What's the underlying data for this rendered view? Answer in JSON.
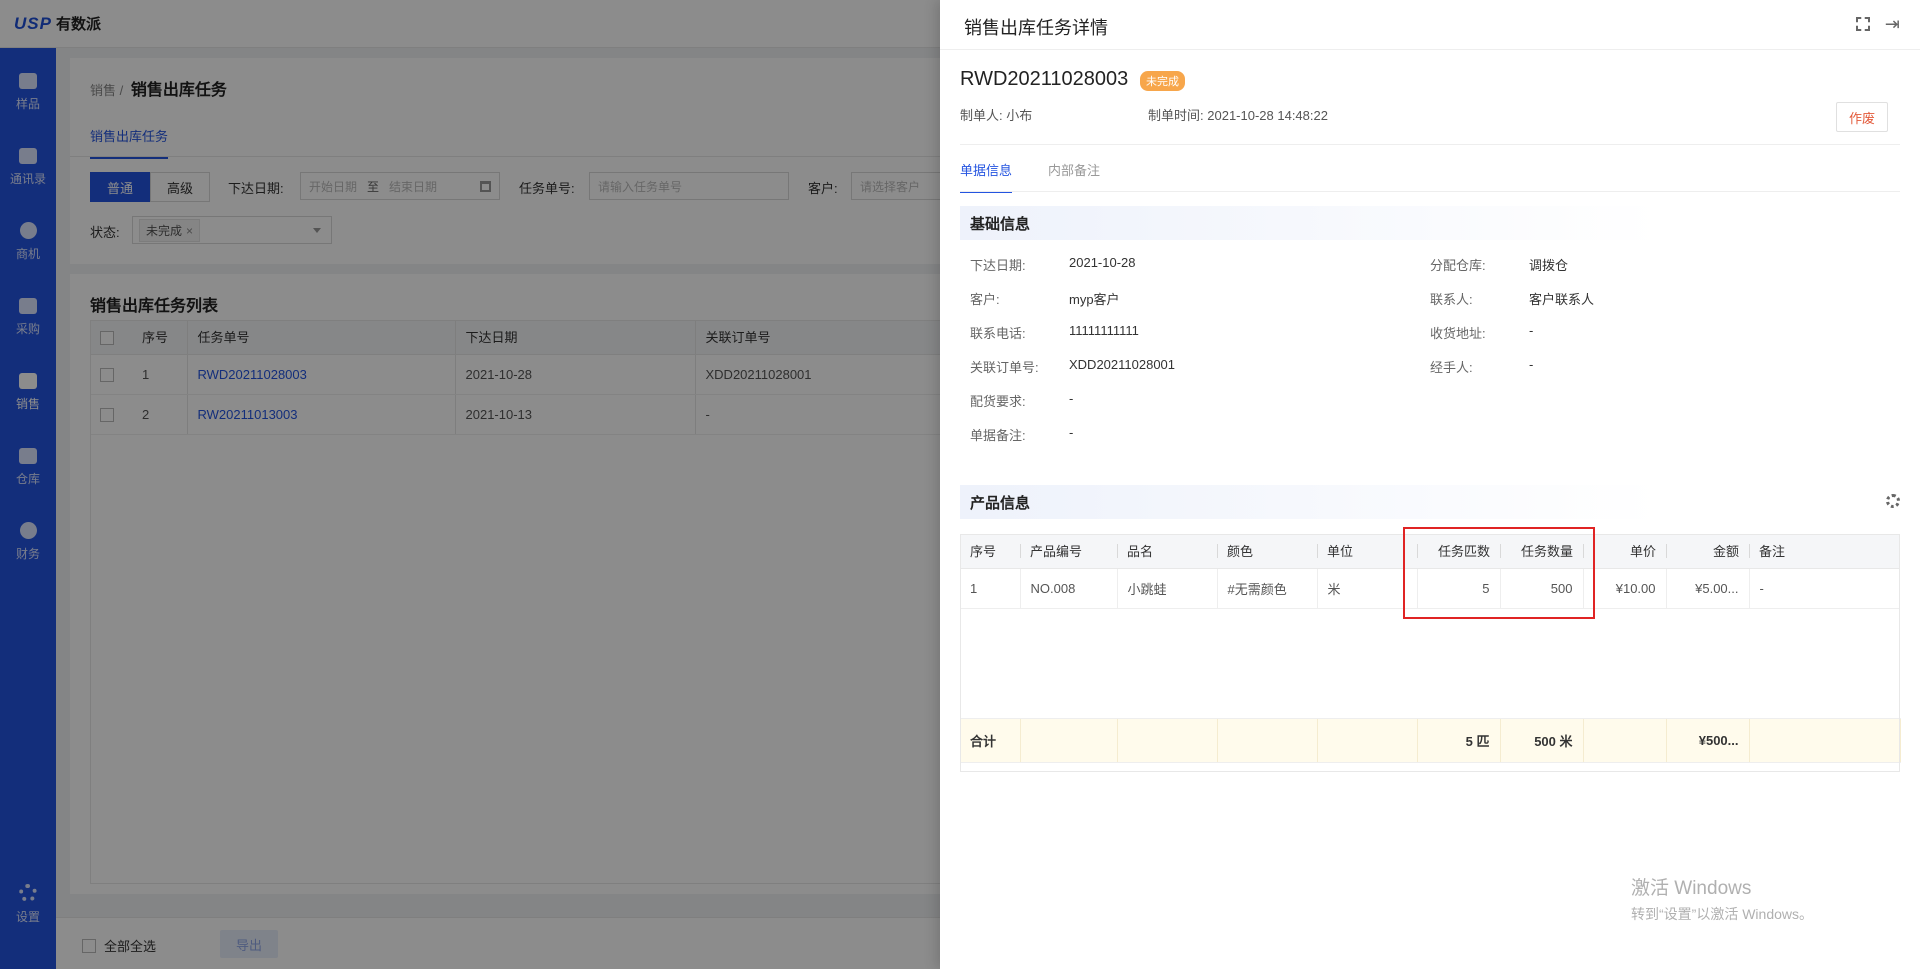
{
  "app": {
    "logo_mark": "USP",
    "logo_name": "有数派"
  },
  "sidebar": {
    "items": [
      {
        "label": "样品",
        "icon": "box-icon"
      },
      {
        "label": "通讯录",
        "icon": "contacts-icon"
      },
      {
        "label": "商机",
        "icon": "opportunity-icon"
      },
      {
        "label": "采购",
        "icon": "purchase-icon"
      },
      {
        "label": "销售",
        "icon": "sales-clipboard-icon",
        "active": true
      },
      {
        "label": "仓库",
        "icon": "warehouse-icon"
      },
      {
        "label": "财务",
        "icon": "finance-bag-icon"
      }
    ],
    "settings": "设置"
  },
  "main": {
    "breadcrumb_root": "销售",
    "breadcrumb_sep": "/",
    "breadcrumb_current": "销售出库任务",
    "subtab": "销售出库任务",
    "mode_normal": "普通",
    "mode_advanced": "高级",
    "filter_date_label": "下达日期:",
    "filter_date_start": "开始日期",
    "filter_date_to": "至",
    "filter_date_end": "结束日期",
    "filter_task_label": "任务单号:",
    "filter_task_placeholder": "请输入任务单号",
    "filter_customer_label": "客户:",
    "filter_customer_placeholder": "请选择客户",
    "filter_status_label": "状态:",
    "filter_status_tag": "未完成",
    "list_title": "销售出库任务列表",
    "columns": [
      "序号",
      "任务单号",
      "下达日期",
      "关联订单号"
    ],
    "rows": [
      {
        "idx": "1",
        "task_no": "RWD20211028003",
        "date": "2021-10-28",
        "order_no": "XDD20211028001"
      },
      {
        "idx": "2",
        "task_no": "RW20211013003",
        "date": "2021-10-13",
        "order_no": "-"
      }
    ],
    "select_all": "全部全选",
    "export": "导出"
  },
  "drawer": {
    "title": "销售出库任务详情",
    "doc_no": "RWD20211028003",
    "status": "未完成",
    "creator_label": "制单人:",
    "creator": "小布",
    "created_label": "制单时间:",
    "created_at": "2021-10-28 14:48:22",
    "void_button": "作废",
    "tabs": [
      "单据信息",
      "内部备注"
    ],
    "basic_title": "基础信息",
    "basic": {
      "issue_date_label": "下达日期:",
      "issue_date": "2021-10-28",
      "warehouse_label": "分配仓库:",
      "warehouse": "调拨仓",
      "customer_label": "客户:",
      "customer": "myp客户",
      "contact_label": "联系人:",
      "contact": "客户联系人",
      "phone_label": "联系电话:",
      "phone": "11111111111",
      "address_label": "收货地址:",
      "address": "-",
      "order_label": "关联订单号:",
      "order": "XDD20211028001",
      "handler_label": "经手人:",
      "handler": "-",
      "requirement_label": "配货要求:",
      "requirement": "-",
      "remark_label": "单据备注:",
      "remark": "-"
    },
    "product_title": "产品信息",
    "product_columns": [
      "序号",
      "产品编号",
      "品名",
      "颜色",
      "单位",
      "任务匹数",
      "任务数量",
      "单价",
      "金额",
      "备注"
    ],
    "product_rows": [
      {
        "idx": "1",
        "code": "NO.008",
        "name": "小跳蛙",
        "color": "#无需颜色",
        "unit": "米",
        "pieces": "5",
        "qty": "500",
        "price": "¥10.00",
        "amount": "¥5.00...",
        "note": "-"
      }
    ],
    "total": {
      "label": "合计",
      "pieces": "5 匹",
      "qty": "500 米",
      "amount": "¥500..."
    }
  },
  "watermark": {
    "line1": "激活 Windows",
    "line2": "转到“设置”以激活 Windows。"
  }
}
